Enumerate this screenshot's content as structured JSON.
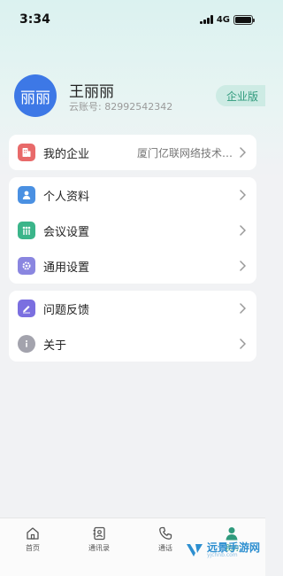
{
  "status": {
    "time": "3:34",
    "network": "4G"
  },
  "profile": {
    "avatar_text": "丽丽",
    "name": "王丽丽",
    "account": "云账号: 82992542342",
    "badge": "企业版"
  },
  "company": {
    "label": "我的企业",
    "value": "厦门亿联网络技术…"
  },
  "settings": [
    {
      "label": "个人资料"
    },
    {
      "label": "会议设置"
    },
    {
      "label": "通用设置"
    }
  ],
  "support": [
    {
      "label": "问题反馈"
    },
    {
      "label": "关于"
    }
  ],
  "tabs": [
    {
      "label": "首页"
    },
    {
      "label": "通讯录"
    },
    {
      "label": "通话"
    },
    {
      "label": "我的"
    }
  ],
  "watermark": {
    "text": "远景手游网",
    "sub": "yjchnb.com"
  },
  "colors": {
    "accent": "#2f9a7c",
    "avatar": "#3d78e6",
    "company_icon": "#e86a6a",
    "profile_icon": "#4a90e2",
    "meeting_icon": "#3bb58a",
    "general_icon": "#8a86e0",
    "feedback_icon": "#7b6fe0",
    "about_icon": "#a3a3ad"
  }
}
